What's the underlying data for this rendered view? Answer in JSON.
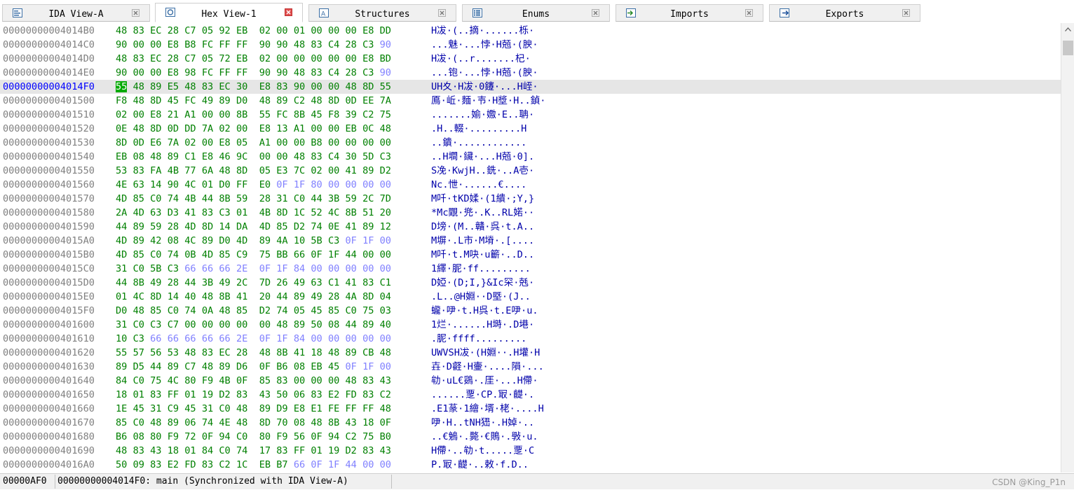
{
  "tabs": [
    {
      "label": "IDA View-A",
      "active": false,
      "icon": "ida-view-icon"
    },
    {
      "label": "Hex View-1",
      "active": true,
      "icon": "hex-view-icon"
    },
    {
      "label": "Structures",
      "active": false,
      "icon": "structures-icon"
    },
    {
      "label": "Enums",
      "active": false,
      "icon": "enums-icon"
    },
    {
      "label": "Imports",
      "active": false,
      "icon": "imports-icon"
    },
    {
      "label": "Exports",
      "active": false,
      "icon": "exports-icon"
    }
  ],
  "hex": {
    "current_row": 4,
    "current_byte": 0,
    "rows": [
      {
        "addr": "00000000004014B0",
        "bytes": "48 83 EC 28 C7 05 92 EB  02 00 01 00 00 00 E8 DD",
        "ascii": "H冹·(..摘·......栎·",
        "dim_from": 16
      },
      {
        "addr": "00000000004014C0",
        "bytes": "90 00 00 E8 B8 FC FF FF  90 90 48 83 C4 28 C3 90",
        "ascii": "...魅·...悖·H兡·(腴·",
        "dim_from": 15
      },
      {
        "addr": "00000000004014D0",
        "bytes": "48 83 EC 28 C7 05 72 EB  02 00 00 00 00 00 E8 BD",
        "ascii": "H冹·(..r.......杞·",
        "dim_from": 16
      },
      {
        "addr": "00000000004014E0",
        "bytes": "90 00 00 E8 98 FC FF FF  90 90 48 83 C4 28 C3 90",
        "ascii": "...铇·...悖·H兡·(腴·",
        "dim_from": 15
      },
      {
        "addr": "00000000004014F0",
        "bytes": "55 48 89 E5 48 83 EC 30  E8 83 90 00 00 48 8D 55",
        "ascii": "UH夊·H冹·0鑳·...H峌·",
        "dim_from": 16
      },
      {
        "addr": "0000000000401500",
        "bytes": "F8 48 8D 45 FC 49 89 D0  48 89 C2 48 8D 0D EE 7A",
        "ascii": "鳫·岴·麵·壭·H墏·H..鍞·",
        "dim_from": 16
      },
      {
        "addr": "0000000000401510",
        "bytes": "02 00 E8 21 A1 00 00 8B  55 FC 8B 45 F8 39 C2 75",
        "ascii": ".......媮·嫐·E..聃·",
        "dim_from": 16
      },
      {
        "addr": "0000000000401520",
        "bytes": "0E 48 8D 0D DD 7A 02 00  E8 13 A1 00 00 EB 0C 48",
        "ascii": ".H..輟·.........H",
        "dim_from": 16
      },
      {
        "addr": "0000000000401530",
        "bytes": "8D 0D E6 7A 02 00 E8 05  A1 00 00 B8 00 00 00 00",
        "ascii": "..鐀·............",
        "dim_from": 16
      },
      {
        "addr": "0000000000401540",
        "bytes": "EB 08 48 89 C1 E8 46 9C  00 00 48 83 C4 30 5D C3",
        "ascii": "..H墹·鑶·...H兡·0].",
        "dim_from": 16
      },
      {
        "addr": "0000000000401550",
        "bytes": "53 83 FA 4B 77 6A 48 8D  05 E3 7C 02 00 41 89 D2",
        "ascii": "S凂·KwjH..銑·..A壱·",
        "dim_from": 16
      },
      {
        "addr": "0000000000401560",
        "bytes": "4E 63 14 90 4C 01 D0 FF  E0 0F 1F 80 00 00 00 00",
        "ascii": "Nc.怈·......€....",
        "dim_from": 9
      },
      {
        "addr": "0000000000401570",
        "bytes": "4D 85 C0 74 4B 44 8B 59  28 31 C0 44 3B 59 2C 7D",
        "ascii": "M吀·tKD媃·(1繢·;Y,}",
        "dim_from": 16
      },
      {
        "addr": "0000000000401580",
        "bytes": "2A 4D 63 D3 41 83 C3 01  4B 8D 1C 52 4C 8B 51 20",
        "ascii": "*Mc覵·兠·.K..RL婼··",
        "dim_from": 16
      },
      {
        "addr": "0000000000401590",
        "bytes": "44 89 59 28 4D 8D 14 DA  4D 85 D2 74 0E 41 89 12",
        "ascii": "D塝·(M..贛·呉·t.A..",
        "dim_from": 16
      },
      {
        "addr": "00000000004015A0",
        "bytes": "4D 89 42 08 4C 89 D0 4D  89 4A 10 5B C3 0F 1F 00",
        "ascii": "M塀·.L市·M塉·.[....",
        "dim_from": 13
      },
      {
        "addr": "00000000004015B0",
        "bytes": "4D 85 C0 74 0B 4D 85 C9  75 BB 66 0F 1F 44 00 00",
        "ascii": "M吀·t.M吷·u籪·..D..",
        "dim_from": 16
      },
      {
        "addr": "00000000004015C0",
        "bytes": "31 C0 5B C3 66 66 66 2E  0F 1F 84 00 00 00 00 00",
        "ascii": "1繹·胒·ff.........",
        "dim_from": 4
      },
      {
        "addr": "00000000004015D0",
        "bytes": "44 8B 49 28 44 3B 49 2C  7D 26 49 63 C1 41 83 C1",
        "ascii": "D婭·(D;I,}&Ic罙·兞·",
        "dim_from": 16
      },
      {
        "addr": "00000000004015E0",
        "bytes": "01 4C 8D 14 40 48 8B 41  20 44 89 49 28 4A 8D 04",
        "ascii": ".L..@H婣··D塈·(J..",
        "dim_from": 16
      },
      {
        "addr": "00000000004015F0",
        "bytes": "D0 48 85 C0 74 0A 48 85  D2 74 05 45 85 C0 75 03",
        "ascii": "蠬·吚·t.H呉·t.E吚·u.",
        "dim_from": 16
      },
      {
        "addr": "0000000000401600",
        "bytes": "31 C0 C3 C7 00 00 00 00  00 48 89 50 08 44 89 40",
        "ascii": "1烂·......H塒·.D塂·",
        "dim_from": 16
      },
      {
        "addr": "0000000000401610",
        "bytes": "10 C3 66 66 66 66 66 2E  0F 1F 84 00 00 00 00 00",
        "ascii": ".胒·ffff.........",
        "dim_from": 2
      },
      {
        "addr": "0000000000401620",
        "bytes": "55 57 56 53 48 83 EC 28  48 8B 41 18 48 89 CB 48",
        "ascii": "UWVSH冹·(H婣··.H壦·H",
        "dim_from": 16
      },
      {
        "addr": "0000000000401630",
        "bytes": "89 D5 44 89 C7 48 89 D6  0F B6 08 EB 45 0F 1F 00",
        "ascii": "壵·D壡·H壷·....隕·...",
        "dim_from": 13
      },
      {
        "addr": "0000000000401640",
        "bytes": "84 C0 75 4C 80 F9 4B 0F  85 83 00 00 00 48 83 43",
        "ascii": "劺·uL€鵎·.厓·...H僀·",
        "dim_from": 16
      },
      {
        "addr": "0000000000401650",
        "bytes": "18 01 83 FF 01 19 D2 83  43 50 06 83 E2 FD 83 C2",
        "ascii": "......覂·CP.冣·齼·.",
        "dim_from": 16
      },
      {
        "addr": "0000000000401660",
        "bytes": "1E 45 31 C9 45 31 C0 48  89 D9 E8 E1 FE FF FF 48",
        "ascii": ".E1蒃·1繪·壻·栳·....H",
        "dim_from": 16
      },
      {
        "addr": "0000000000401670",
        "bytes": "85 C0 48 89 06 74 4E 48  8D 70 08 48 8B 43 18 0F",
        "ascii": "吚·H..tNH峱·.H婥·..",
        "dim_from": 16
      },
      {
        "addr": "0000000000401680",
        "bytes": "B6 08 80 F9 72 0F 94 C0  80 F9 56 0F 94 C2 75 B0",
        "ascii": "..€鵵·.斃·€鵙·.斅·u.",
        "dim_from": 16
      },
      {
        "addr": "0000000000401690",
        "bytes": "48 83 43 18 01 84 C0 74  17 83 FF 01 19 D2 83 43",
        "ascii": "H僀·..劺·t.....覂·C",
        "dim_from": 16
      },
      {
        "addr": "00000000004016A0",
        "bytes": "50 09 83 E2 FD 83 C2 1C  EB B7 66 0F 1F 44 00 00",
        "ascii": "P.冣·齼·..敕·f.D..",
        "dim_from": 10
      }
    ]
  },
  "status": {
    "offset": "00000AF0",
    "location": "00000000004014F0: main (Synchronized with IDA View-A)"
  },
  "watermark": "CSDN @King_P1n"
}
